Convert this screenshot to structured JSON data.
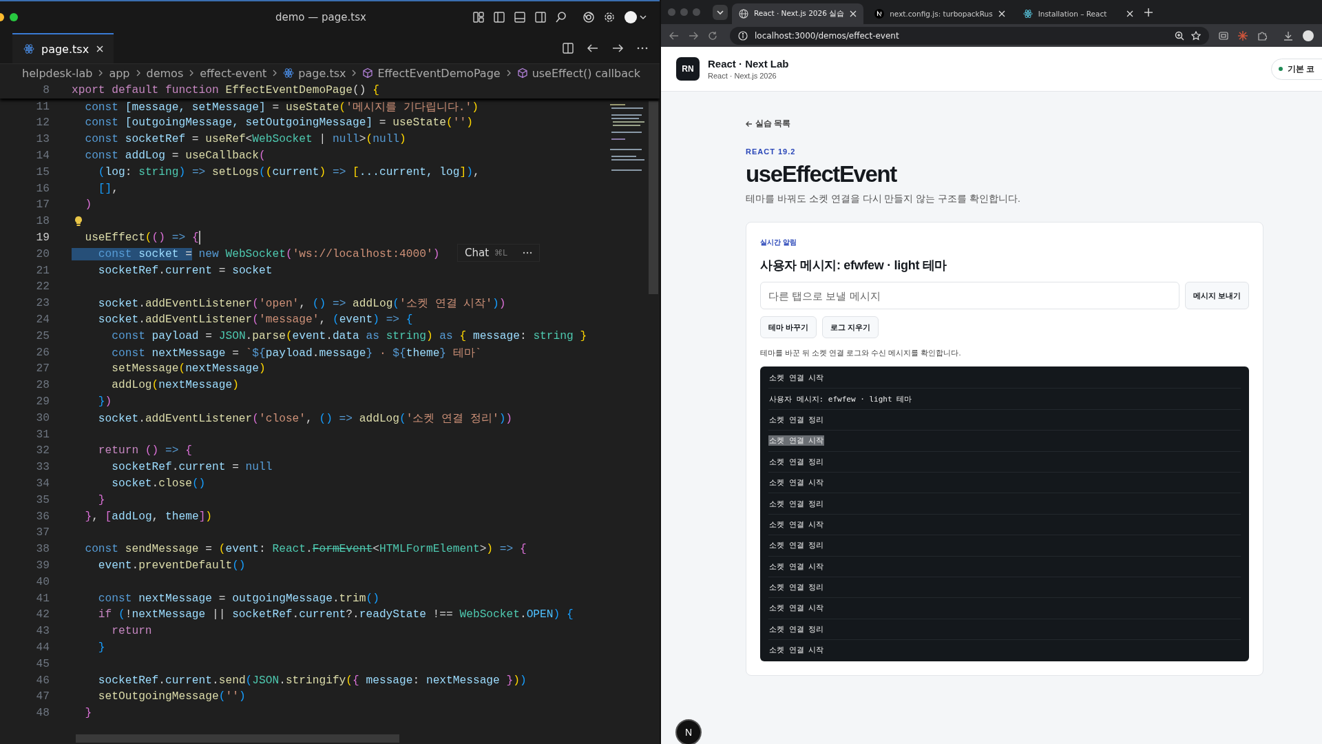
{
  "editor": {
    "window_title": "demo — page.tsx",
    "tabs": [
      {
        "label": "page.tsx",
        "selected": true
      }
    ],
    "breadcrumbs": [
      {
        "label": "helpdesk-lab",
        "kind": "folder"
      },
      {
        "label": "app",
        "kind": "folder"
      },
      {
        "label": "demos",
        "kind": "folder"
      },
      {
        "label": "effect-event",
        "kind": "folder"
      },
      {
        "label": "page.tsx",
        "kind": "file"
      },
      {
        "label": "EffectEventDemoPage",
        "kind": "symbol"
      },
      {
        "label": "useEffect() callback",
        "kind": "symbol"
      }
    ],
    "sticky_line": {
      "number": "8",
      "tokens": [
        {
          "text": "xport default function ",
          "kind": "ctl"
        },
        {
          "text": "EffectEventDemoPage",
          "kind": "fn"
        },
        {
          "text": "() ",
          "kind": "p"
        },
        {
          "text": "{",
          "kind": "b1"
        }
      ]
    },
    "lines": [
      {
        "number": "11",
        "current": false,
        "tokens": [
          {
            "text": "  const ",
            "kind": "kw"
          },
          {
            "text": "[message, setMessage]",
            "kind": "var"
          },
          {
            "text": " = ",
            "kind": "p"
          },
          {
            "text": "useState",
            "kind": "fn"
          },
          {
            "text": "(",
            "kind": "b1"
          },
          {
            "text": "'메시지를 기다립니다.'",
            "kind": "str"
          },
          {
            "text": ")",
            "kind": "b1"
          }
        ]
      },
      {
        "number": "12",
        "current": false,
        "tokens": [
          {
            "text": "  const ",
            "kind": "kw"
          },
          {
            "text": "[outgoingMessage, setOutgoingMessage]",
            "kind": "var"
          },
          {
            "text": " = ",
            "kind": "p"
          },
          {
            "text": "useState",
            "kind": "fn"
          },
          {
            "text": "(",
            "kind": "b1"
          },
          {
            "text": "''",
            "kind": "str"
          },
          {
            "text": ")",
            "kind": "b1"
          }
        ]
      },
      {
        "number": "13",
        "current": false,
        "tokens": [
          {
            "text": "  const ",
            "kind": "kw"
          },
          {
            "text": "socketRef",
            "kind": "var"
          },
          {
            "text": " = ",
            "kind": "p"
          },
          {
            "text": "useRef",
            "kind": "fn"
          },
          {
            "text": "<",
            "kind": "p"
          },
          {
            "text": "WebSocket",
            "kind": "type"
          },
          {
            "text": " | ",
            "kind": "p"
          },
          {
            "text": "null",
            "kind": "kw"
          },
          {
            "text": ">",
            "kind": "p"
          },
          {
            "text": "(",
            "kind": "b1"
          },
          {
            "text": "null",
            "kind": "kw"
          },
          {
            "text": ")",
            "kind": "b1"
          }
        ]
      },
      {
        "number": "14",
        "current": false,
        "tokens": [
          {
            "text": "  const ",
            "kind": "kw"
          },
          {
            "text": "addLog",
            "kind": "var"
          },
          {
            "text": " = ",
            "kind": "p"
          },
          {
            "text": "useCallback",
            "kind": "fn"
          },
          {
            "text": "(",
            "kind": "b2"
          }
        ]
      },
      {
        "number": "15",
        "current": false,
        "tokens": [
          {
            "text": "    (",
            "kind": "b3"
          },
          {
            "text": "log",
            "kind": "var"
          },
          {
            "text": ": ",
            "kind": "p"
          },
          {
            "text": "string",
            "kind": "type"
          },
          {
            "text": ")",
            "kind": "b3"
          },
          {
            "text": " => ",
            "kind": "kw"
          },
          {
            "text": "setLogs",
            "kind": "fn"
          },
          {
            "text": "(",
            "kind": "b3"
          },
          {
            "text": "(",
            "kind": "b1"
          },
          {
            "text": "current",
            "kind": "var"
          },
          {
            "text": ")",
            "kind": "b1"
          },
          {
            "text": " => ",
            "kind": "kw"
          },
          {
            "text": "[",
            "kind": "b1"
          },
          {
            "text": "...current, log",
            "kind": "var"
          },
          {
            "text": "]",
            "kind": "b1"
          },
          {
            "text": ")",
            "kind": "b3"
          },
          {
            "text": ",",
            "kind": "p"
          }
        ]
      },
      {
        "number": "16",
        "current": false,
        "tokens": [
          {
            "text": "    []",
            "kind": "b3"
          },
          {
            "text": ",",
            "kind": "p"
          }
        ]
      },
      {
        "number": "17",
        "current": false,
        "tokens": [
          {
            "text": "  )",
            "kind": "b2"
          }
        ]
      },
      {
        "number": "18",
        "current": false,
        "lightbulb": true
      },
      {
        "number": "19",
        "current": true,
        "tokens": [
          {
            "text": "  useEffect",
            "kind": "fn"
          },
          {
            "text": "(",
            "kind": "b1"
          },
          {
            "text": "()",
            "kind": "b2"
          },
          {
            "text": " => ",
            "kind": "kw"
          },
          {
            "text": "{",
            "kind": "b2"
          }
        ]
      },
      {
        "number": "20",
        "current": false,
        "selection": [
          {
            "text": "    const ",
            "kind": "kw"
          },
          {
            "text": "socket",
            "kind": "var"
          },
          {
            "text": " =",
            "kind": "p"
          }
        ],
        "tokens": [
          {
            "text": " new ",
            "kind": "kw"
          },
          {
            "text": "WebSocket",
            "kind": "type"
          },
          {
            "text": "(",
            "kind": "b2"
          },
          {
            "text": "'ws://localhost:4000'",
            "kind": "str"
          },
          {
            "text": ")",
            "kind": "b2"
          }
        ]
      },
      {
        "number": "21",
        "current": false,
        "tokens": [
          {
            "text": "    socketRef",
            "kind": "var"
          },
          {
            "text": ".",
            "kind": "p"
          },
          {
            "text": "current",
            "kind": "var"
          },
          {
            "text": " = ",
            "kind": "p"
          },
          {
            "text": "socket",
            "kind": "var"
          }
        ]
      },
      {
        "number": "22",
        "current": false
      },
      {
        "number": "23",
        "current": false,
        "tokens": [
          {
            "text": "    socket",
            "kind": "var"
          },
          {
            "text": ".",
            "kind": "p"
          },
          {
            "text": "addEventListener",
            "kind": "fn"
          },
          {
            "text": "(",
            "kind": "b2"
          },
          {
            "text": "'open'",
            "kind": "str"
          },
          {
            "text": ", ",
            "kind": "p"
          },
          {
            "text": "()",
            "kind": "b3"
          },
          {
            "text": " => ",
            "kind": "kw"
          },
          {
            "text": "addLog",
            "kind": "fn"
          },
          {
            "text": "(",
            "kind": "b3"
          },
          {
            "text": "'소켓 연결 시작'",
            "kind": "str"
          },
          {
            "text": ")",
            "kind": "b3"
          },
          {
            "text": ")",
            "kind": "b2"
          }
        ]
      },
      {
        "number": "24",
        "current": false,
        "tokens": [
          {
            "text": "    socket",
            "kind": "var"
          },
          {
            "text": ".",
            "kind": "p"
          },
          {
            "text": "addEventListener",
            "kind": "fn"
          },
          {
            "text": "(",
            "kind": "b2"
          },
          {
            "text": "'message'",
            "kind": "str"
          },
          {
            "text": ", ",
            "kind": "p"
          },
          {
            "text": "(",
            "kind": "b3"
          },
          {
            "text": "event",
            "kind": "var"
          },
          {
            "text": ")",
            "kind": "b3"
          },
          {
            "text": " => ",
            "kind": "kw"
          },
          {
            "text": "{",
            "kind": "b3"
          }
        ]
      },
      {
        "number": "25",
        "current": false,
        "tokens": [
          {
            "text": "      const ",
            "kind": "kw"
          },
          {
            "text": "payload",
            "kind": "var"
          },
          {
            "text": " = ",
            "kind": "p"
          },
          {
            "text": "JSON",
            "kind": "type"
          },
          {
            "text": ".",
            "kind": "p"
          },
          {
            "text": "parse",
            "kind": "fn"
          },
          {
            "text": "(",
            "kind": "b1"
          },
          {
            "text": "event",
            "kind": "var"
          },
          {
            "text": ".",
            "kind": "p"
          },
          {
            "text": "data",
            "kind": "var"
          },
          {
            "text": " as ",
            "kind": "kw"
          },
          {
            "text": "string",
            "kind": "type"
          },
          {
            "text": ")",
            "kind": "b1"
          },
          {
            "text": " as ",
            "kind": "kw"
          },
          {
            "text": "{ ",
            "kind": "b1"
          },
          {
            "text": "message",
            "kind": "var"
          },
          {
            "text": ": ",
            "kind": "p"
          },
          {
            "text": "string",
            "kind": "type"
          },
          {
            "text": " }",
            "kind": "b1"
          }
        ]
      },
      {
        "number": "26",
        "current": false,
        "tokens": [
          {
            "text": "      const ",
            "kind": "kw"
          },
          {
            "text": "nextMessage",
            "kind": "var"
          },
          {
            "text": " = ",
            "kind": "p"
          },
          {
            "text": "`",
            "kind": "str"
          },
          {
            "text": "${",
            "kind": "kw"
          },
          {
            "text": "payload",
            "kind": "var"
          },
          {
            "text": ".",
            "kind": "p"
          },
          {
            "text": "message",
            "kind": "var"
          },
          {
            "text": "}",
            "kind": "kw"
          },
          {
            "text": " · ",
            "kind": "str"
          },
          {
            "text": "${",
            "kind": "kw"
          },
          {
            "text": "theme",
            "kind": "var"
          },
          {
            "text": "}",
            "kind": "kw"
          },
          {
            "text": " 테마`",
            "kind": "str"
          }
        ]
      },
      {
        "number": "27",
        "current": false,
        "tokens": [
          {
            "text": "      setMessage",
            "kind": "fn"
          },
          {
            "text": "(",
            "kind": "b1"
          },
          {
            "text": "nextMessage",
            "kind": "var"
          },
          {
            "text": ")",
            "kind": "b1"
          }
        ]
      },
      {
        "number": "28",
        "current": false,
        "tokens": [
          {
            "text": "      addLog",
            "kind": "fn"
          },
          {
            "text": "(",
            "kind": "b1"
          },
          {
            "text": "nextMessage",
            "kind": "var"
          },
          {
            "text": ")",
            "kind": "b1"
          }
        ]
      },
      {
        "number": "29",
        "current": false,
        "tokens": [
          {
            "text": "    }",
            "kind": "b3"
          },
          {
            "text": ")",
            "kind": "b2"
          }
        ]
      },
      {
        "number": "30",
        "current": false,
        "tokens": [
          {
            "text": "    socket",
            "kind": "var"
          },
          {
            "text": ".",
            "kind": "p"
          },
          {
            "text": "addEventListener",
            "kind": "fn"
          },
          {
            "text": "(",
            "kind": "b2"
          },
          {
            "text": "'close'",
            "kind": "str"
          },
          {
            "text": ", ",
            "kind": "p"
          },
          {
            "text": "()",
            "kind": "b3"
          },
          {
            "text": " => ",
            "kind": "kw"
          },
          {
            "text": "addLog",
            "kind": "fn"
          },
          {
            "text": "(",
            "kind": "b3"
          },
          {
            "text": "'소켓 연결 정리'",
            "kind": "str"
          },
          {
            "text": ")",
            "kind": "b3"
          },
          {
            "text": ")",
            "kind": "b2"
          }
        ]
      },
      {
        "number": "31",
        "current": false
      },
      {
        "number": "32",
        "current": false,
        "tokens": [
          {
            "text": "    return ",
            "kind": "ctl"
          },
          {
            "text": "()",
            "kind": "b2"
          },
          {
            "text": " => ",
            "kind": "kw"
          },
          {
            "text": "{",
            "kind": "b2"
          }
        ]
      },
      {
        "number": "33",
        "current": false,
        "tokens": [
          {
            "text": "      socketRef",
            "kind": "var"
          },
          {
            "text": ".",
            "kind": "p"
          },
          {
            "text": "current",
            "kind": "var"
          },
          {
            "text": " = ",
            "kind": "p"
          },
          {
            "text": "null",
            "kind": "kw"
          }
        ]
      },
      {
        "number": "34",
        "current": false,
        "tokens": [
          {
            "text": "      socket",
            "kind": "var"
          },
          {
            "text": ".",
            "kind": "p"
          },
          {
            "text": "close",
            "kind": "fn"
          },
          {
            "text": "()",
            "kind": "b3"
          }
        ]
      },
      {
        "number": "35",
        "current": false,
        "tokens": [
          {
            "text": "    }",
            "kind": "b2"
          }
        ]
      },
      {
        "number": "36",
        "current": false,
        "tokens": [
          {
            "text": "  }",
            "kind": "b2"
          },
          {
            "text": ", ",
            "kind": "p"
          },
          {
            "text": "[",
            "kind": "b2"
          },
          {
            "text": "addLog",
            "kind": "var"
          },
          {
            "text": ", ",
            "kind": "p"
          },
          {
            "text": "theme",
            "kind": "var"
          },
          {
            "text": "]",
            "kind": "b2"
          },
          {
            "text": ")",
            "kind": "b1"
          }
        ]
      },
      {
        "number": "37",
        "current": false
      },
      {
        "number": "38",
        "current": false,
        "tokens": [
          {
            "text": "  const ",
            "kind": "kw"
          },
          {
            "text": "sendMessage",
            "kind": "fn"
          },
          {
            "text": " = ",
            "kind": "p"
          },
          {
            "text": "(",
            "kind": "b1"
          },
          {
            "text": "event",
            "kind": "var"
          },
          {
            "text": ": ",
            "kind": "p"
          },
          {
            "text": "React",
            "kind": "type"
          },
          {
            "text": ".",
            "kind": "p"
          },
          {
            "text": "FormEvent",
            "kind": "dep"
          },
          {
            "text": "<",
            "kind": "p"
          },
          {
            "text": "HTMLFormElement",
            "kind": "type"
          },
          {
            "text": ">",
            "kind": "p"
          },
          {
            "text": ")",
            "kind": "b1"
          },
          {
            "text": " => ",
            "kind": "kw"
          },
          {
            "text": "{",
            "kind": "b2"
          }
        ]
      },
      {
        "number": "39",
        "current": false,
        "tokens": [
          {
            "text": "    event",
            "kind": "var"
          },
          {
            "text": ".",
            "kind": "p"
          },
          {
            "text": "preventDefault",
            "kind": "fn"
          },
          {
            "text": "()",
            "kind": "b3"
          }
        ]
      },
      {
        "number": "40",
        "current": false
      },
      {
        "number": "41",
        "current": false,
        "tokens": [
          {
            "text": "    const ",
            "kind": "kw"
          },
          {
            "text": "nextMessage",
            "kind": "var"
          },
          {
            "text": " = ",
            "kind": "p"
          },
          {
            "text": "outgoingMessage",
            "kind": "var"
          },
          {
            "text": ".",
            "kind": "p"
          },
          {
            "text": "trim",
            "kind": "fn"
          },
          {
            "text": "()",
            "kind": "b3"
          }
        ]
      },
      {
        "number": "42",
        "current": false,
        "tokens": [
          {
            "text": "    if ",
            "kind": "ctl"
          },
          {
            "text": "(",
            "kind": "b3"
          },
          {
            "text": "!",
            "kind": "p"
          },
          {
            "text": "nextMessage",
            "kind": "var"
          },
          {
            "text": " || ",
            "kind": "p"
          },
          {
            "text": "socketRef",
            "kind": "var"
          },
          {
            "text": ".",
            "kind": "p"
          },
          {
            "text": "current",
            "kind": "var"
          },
          {
            "text": "?.",
            "kind": "p"
          },
          {
            "text": "readyState",
            "kind": "var"
          },
          {
            "text": " !== ",
            "kind": "p"
          },
          {
            "text": "WebSocket",
            "kind": "type"
          },
          {
            "text": ".",
            "kind": "p"
          },
          {
            "text": "OPEN",
            "kind": "cst"
          },
          {
            "text": ")",
            "kind": "b3"
          },
          {
            "text": " {",
            "kind": "b3"
          }
        ]
      },
      {
        "number": "43",
        "current": false,
        "tokens": [
          {
            "text": "      return",
            "kind": "ctl"
          }
        ]
      },
      {
        "number": "44",
        "current": false,
        "tokens": [
          {
            "text": "    }",
            "kind": "b3"
          }
        ]
      },
      {
        "number": "45",
        "current": false
      },
      {
        "number": "46",
        "current": false,
        "tokens": [
          {
            "text": "    socketRef",
            "kind": "var"
          },
          {
            "text": ".",
            "kind": "p"
          },
          {
            "text": "current",
            "kind": "var"
          },
          {
            "text": ".",
            "kind": "p"
          },
          {
            "text": "send",
            "kind": "fn"
          },
          {
            "text": "(",
            "kind": "b3"
          },
          {
            "text": "JSON",
            "kind": "type"
          },
          {
            "text": ".",
            "kind": "p"
          },
          {
            "text": "stringify",
            "kind": "fn"
          },
          {
            "text": "(",
            "kind": "b1"
          },
          {
            "text": "{ ",
            "kind": "b2"
          },
          {
            "text": "message",
            "kind": "var"
          },
          {
            "text": ": ",
            "kind": "p"
          },
          {
            "text": "nextMessage",
            "kind": "var"
          },
          {
            "text": " }",
            "kind": "b2"
          },
          {
            "text": ")",
            "kind": "b1"
          },
          {
            "text": ")",
            "kind": "b3"
          }
        ]
      },
      {
        "number": "47",
        "current": false,
        "tokens": [
          {
            "text": "    setOutgoingMessage",
            "kind": "fn"
          },
          {
            "text": "(",
            "kind": "b3"
          },
          {
            "text": "''",
            "kind": "str"
          },
          {
            "text": ")",
            "kind": "b3"
          }
        ]
      },
      {
        "number": "48",
        "current": false,
        "tokens": [
          {
            "text": "  }",
            "kind": "b2"
          }
        ]
      }
    ],
    "chat_hint": {
      "label": "Chat",
      "shortcut": "⌘L"
    }
  },
  "browser": {
    "tabs": [
      {
        "label": "React · Next.js 2026 실습",
        "kind": "globe",
        "selected": true
      },
      {
        "label": "next.config.js: turbopackRus",
        "kind": "next",
        "selected": false
      },
      {
        "label": "Installation – React",
        "kind": "react",
        "selected": false
      }
    ],
    "address": "localhost:3000/demos/effect-event",
    "site_header": {
      "logo": "RN",
      "title": "React · Next Lab",
      "subtitle": "React · Next.js 2026",
      "status_chip": "기본 코"
    },
    "back_link": "실습 목록",
    "eyebrow": "REACT 19.2",
    "title": "useEffectEvent",
    "description": "테마를 바꿔도 소켓 연결을 다시 만들지 않는 구조를 확인합니다.",
    "card": {
      "label": "실시간 알림",
      "message": "사용자 메시지: efwfew · light 테마",
      "input": {
        "placeholder": "다른 탭으로 보낼 메시지"
      },
      "send_button": "메시지 보내기",
      "buttons": [
        "테마 바꾸기",
        "로그 지우기"
      ],
      "hint": "테마를 바꾼 뒤 소켓 연결 로그와 수신 메시지를 확인합니다.",
      "log": [
        {
          "text": "소켓 연결 시작",
          "highlighted": false
        },
        {
          "text": "사용자 메시지: efwfew · light 테마",
          "highlighted": false
        },
        {
          "text": "소켓 연결 정리",
          "highlighted": false
        },
        {
          "text": "소켓 연결 시작",
          "highlighted": true
        },
        {
          "text": "소켓 연결 정리",
          "highlighted": false
        },
        {
          "text": "소켓 연결 시작",
          "highlighted": false
        },
        {
          "text": "소켓 연결 정리",
          "highlighted": false
        },
        {
          "text": "소켓 연결 시작",
          "highlighted": false
        },
        {
          "text": "소켓 연결 정리",
          "highlighted": false
        },
        {
          "text": "소켓 연결 시작",
          "highlighted": false
        },
        {
          "text": "소켓 연결 정리",
          "highlighted": false
        },
        {
          "text": "소켓 연결 시작",
          "highlighted": false
        },
        {
          "text": "소켓 연결 정리",
          "highlighted": false
        },
        {
          "text": "소켓 연결 시작",
          "highlighted": false
        }
      ]
    },
    "dev_badge": "N"
  }
}
